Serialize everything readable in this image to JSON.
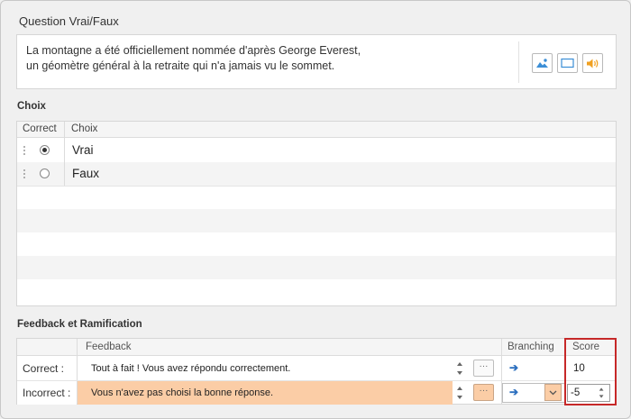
{
  "question": {
    "title": "Question Vrai/Faux",
    "text_line1": "La montagne a été officiellement nommée d'après George Everest,",
    "text_line2": "un géomètre général à la retraite qui n'a jamais vu le sommet.",
    "media_buttons": [
      "image-icon",
      "video-icon",
      "audio-icon"
    ]
  },
  "choices": {
    "label": "Choix",
    "col_correct": "Correct",
    "col_choice": "Choix",
    "rows": [
      {
        "text": "Vrai",
        "selected": true
      },
      {
        "text": "Faux",
        "selected": false
      }
    ]
  },
  "feedback": {
    "label": "Feedback et Ramification",
    "col_feedback": "Feedback",
    "col_branching": "Branching",
    "col_score": "Score",
    "rows": [
      {
        "label": "Correct :",
        "text": "Tout à fait ! Vous avez répondu correctement.",
        "score": "10"
      },
      {
        "label": "Incorrect :",
        "text": "Vous n'avez pas choisi la bonne réponse.",
        "score": "-5"
      }
    ],
    "dots_label": "···",
    "highlight_color": "#fbcda6",
    "score_frame_color": "#c62828"
  }
}
